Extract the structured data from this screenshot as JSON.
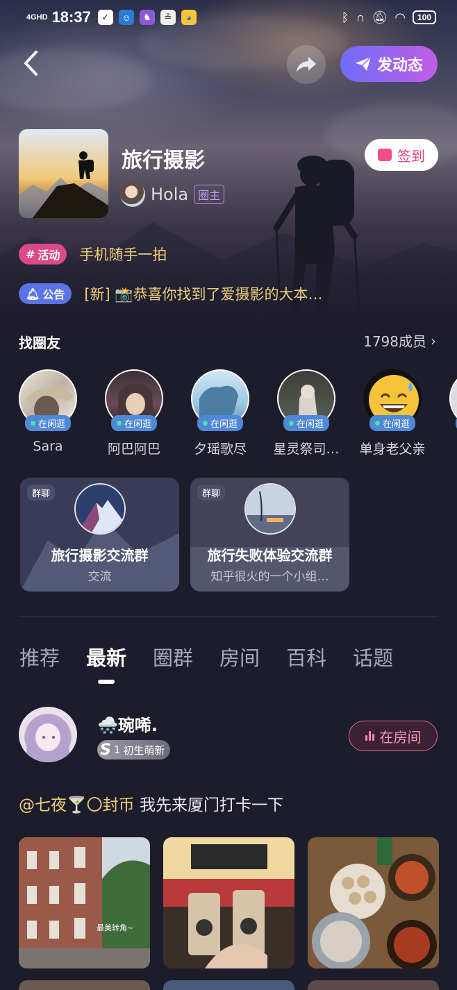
{
  "status_bar": {
    "network": "4GHD",
    "time": "18:37",
    "battery": "100"
  },
  "header": {
    "back_icon": "chevron-left-icon",
    "share_icon": "share-arrow-icon",
    "post_button": "发动态",
    "post_icon": "paper-plane-icon"
  },
  "circle": {
    "title": "旅行摄影",
    "owner_name": "Hola",
    "owner_role": "圈主",
    "checkin_label": "签到",
    "activity_tag": "活动",
    "activity_text": "手机随手一拍",
    "notice_tag": "公告",
    "notice_text": "[新] 📸恭喜你找到了爱摄影的大本…"
  },
  "find_friends": {
    "title": "找圈友",
    "member_count": "1798成员",
    "status_label": "在闲逛",
    "friends": [
      {
        "name": "Sara"
      },
      {
        "name": "阿巴阿巴"
      },
      {
        "name": "夕瑶歌尽"
      },
      {
        "name": "星灵祭司…"
      },
      {
        "name": "单身老父亲"
      },
      {
        "name": "❄"
      }
    ]
  },
  "groups": {
    "tag": "群聊",
    "items": [
      {
        "name": "旅行摄影交流群",
        "desc": "交流"
      },
      {
        "name": "旅行失败体验交流群",
        "desc": "知乎很火的一个小组…"
      }
    ]
  },
  "tabs": [
    "推荐",
    "最新",
    "圈群",
    "房间",
    "百科",
    "话题"
  ],
  "active_tab": "最新",
  "post": {
    "username": "🌨️琬唏.",
    "level_letter": "S",
    "level_num": "1",
    "level_text": "初生萌新",
    "in_room_label": "在房间",
    "mention": "@七夜🍸〇封币",
    "text": " 我先来厦门打卡一下",
    "photo_caption": "最美转角~"
  },
  "colors": {
    "background": "#1d1c2b",
    "accent_gold": "#f0cf7a",
    "post_gradient_start": "#6f6df6",
    "post_gradient_end": "#c25ce8",
    "online_badge": "#4f88d6",
    "checkin_pink": "#e5407e"
  }
}
